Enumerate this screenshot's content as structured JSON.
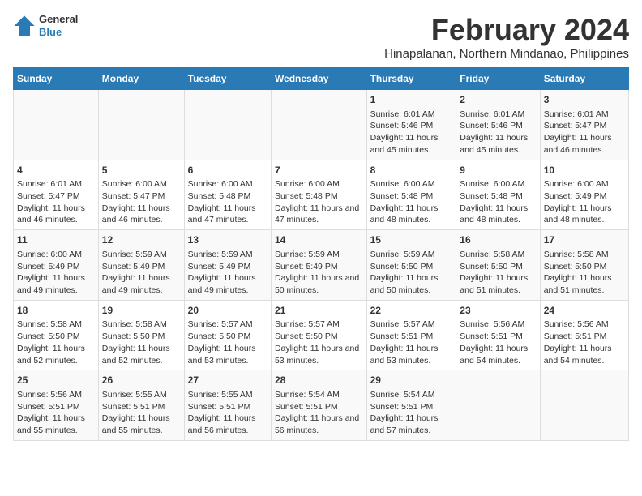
{
  "header": {
    "logo_line1": "General",
    "logo_line2": "Blue",
    "title": "February 2024",
    "subtitle": "Hinapalanan, Northern Mindanao, Philippines"
  },
  "days_of_week": [
    "Sunday",
    "Monday",
    "Tuesday",
    "Wednesday",
    "Thursday",
    "Friday",
    "Saturday"
  ],
  "weeks": [
    [
      {
        "day": "",
        "info": ""
      },
      {
        "day": "",
        "info": ""
      },
      {
        "day": "",
        "info": ""
      },
      {
        "day": "",
        "info": ""
      },
      {
        "day": "1",
        "info": "Sunrise: 6:01 AM\nSunset: 5:46 PM\nDaylight: 11 hours and 45 minutes."
      },
      {
        "day": "2",
        "info": "Sunrise: 6:01 AM\nSunset: 5:46 PM\nDaylight: 11 hours and 45 minutes."
      },
      {
        "day": "3",
        "info": "Sunrise: 6:01 AM\nSunset: 5:47 PM\nDaylight: 11 hours and 46 minutes."
      }
    ],
    [
      {
        "day": "4",
        "info": "Sunrise: 6:01 AM\nSunset: 5:47 PM\nDaylight: 11 hours and 46 minutes."
      },
      {
        "day": "5",
        "info": "Sunrise: 6:00 AM\nSunset: 5:47 PM\nDaylight: 11 hours and 46 minutes."
      },
      {
        "day": "6",
        "info": "Sunrise: 6:00 AM\nSunset: 5:48 PM\nDaylight: 11 hours and 47 minutes."
      },
      {
        "day": "7",
        "info": "Sunrise: 6:00 AM\nSunset: 5:48 PM\nDaylight: 11 hours and 47 minutes."
      },
      {
        "day": "8",
        "info": "Sunrise: 6:00 AM\nSunset: 5:48 PM\nDaylight: 11 hours and 48 minutes."
      },
      {
        "day": "9",
        "info": "Sunrise: 6:00 AM\nSunset: 5:48 PM\nDaylight: 11 hours and 48 minutes."
      },
      {
        "day": "10",
        "info": "Sunrise: 6:00 AM\nSunset: 5:49 PM\nDaylight: 11 hours and 48 minutes."
      }
    ],
    [
      {
        "day": "11",
        "info": "Sunrise: 6:00 AM\nSunset: 5:49 PM\nDaylight: 11 hours and 49 minutes."
      },
      {
        "day": "12",
        "info": "Sunrise: 5:59 AM\nSunset: 5:49 PM\nDaylight: 11 hours and 49 minutes."
      },
      {
        "day": "13",
        "info": "Sunrise: 5:59 AM\nSunset: 5:49 PM\nDaylight: 11 hours and 49 minutes."
      },
      {
        "day": "14",
        "info": "Sunrise: 5:59 AM\nSunset: 5:49 PM\nDaylight: 11 hours and 50 minutes."
      },
      {
        "day": "15",
        "info": "Sunrise: 5:59 AM\nSunset: 5:50 PM\nDaylight: 11 hours and 50 minutes."
      },
      {
        "day": "16",
        "info": "Sunrise: 5:58 AM\nSunset: 5:50 PM\nDaylight: 11 hours and 51 minutes."
      },
      {
        "day": "17",
        "info": "Sunrise: 5:58 AM\nSunset: 5:50 PM\nDaylight: 11 hours and 51 minutes."
      }
    ],
    [
      {
        "day": "18",
        "info": "Sunrise: 5:58 AM\nSunset: 5:50 PM\nDaylight: 11 hours and 52 minutes."
      },
      {
        "day": "19",
        "info": "Sunrise: 5:58 AM\nSunset: 5:50 PM\nDaylight: 11 hours and 52 minutes."
      },
      {
        "day": "20",
        "info": "Sunrise: 5:57 AM\nSunset: 5:50 PM\nDaylight: 11 hours and 53 minutes."
      },
      {
        "day": "21",
        "info": "Sunrise: 5:57 AM\nSunset: 5:50 PM\nDaylight: 11 hours and 53 minutes."
      },
      {
        "day": "22",
        "info": "Sunrise: 5:57 AM\nSunset: 5:51 PM\nDaylight: 11 hours and 53 minutes."
      },
      {
        "day": "23",
        "info": "Sunrise: 5:56 AM\nSunset: 5:51 PM\nDaylight: 11 hours and 54 minutes."
      },
      {
        "day": "24",
        "info": "Sunrise: 5:56 AM\nSunset: 5:51 PM\nDaylight: 11 hours and 54 minutes."
      }
    ],
    [
      {
        "day": "25",
        "info": "Sunrise: 5:56 AM\nSunset: 5:51 PM\nDaylight: 11 hours and 55 minutes."
      },
      {
        "day": "26",
        "info": "Sunrise: 5:55 AM\nSunset: 5:51 PM\nDaylight: 11 hours and 55 minutes."
      },
      {
        "day": "27",
        "info": "Sunrise: 5:55 AM\nSunset: 5:51 PM\nDaylight: 11 hours and 56 minutes."
      },
      {
        "day": "28",
        "info": "Sunrise: 5:54 AM\nSunset: 5:51 PM\nDaylight: 11 hours and 56 minutes."
      },
      {
        "day": "29",
        "info": "Sunrise: 5:54 AM\nSunset: 5:51 PM\nDaylight: 11 hours and 57 minutes."
      },
      {
        "day": "",
        "info": ""
      },
      {
        "day": "",
        "info": ""
      }
    ]
  ],
  "colors": {
    "header_bg": "#2a7ab5",
    "logo_blue": "#2a7ab5"
  }
}
